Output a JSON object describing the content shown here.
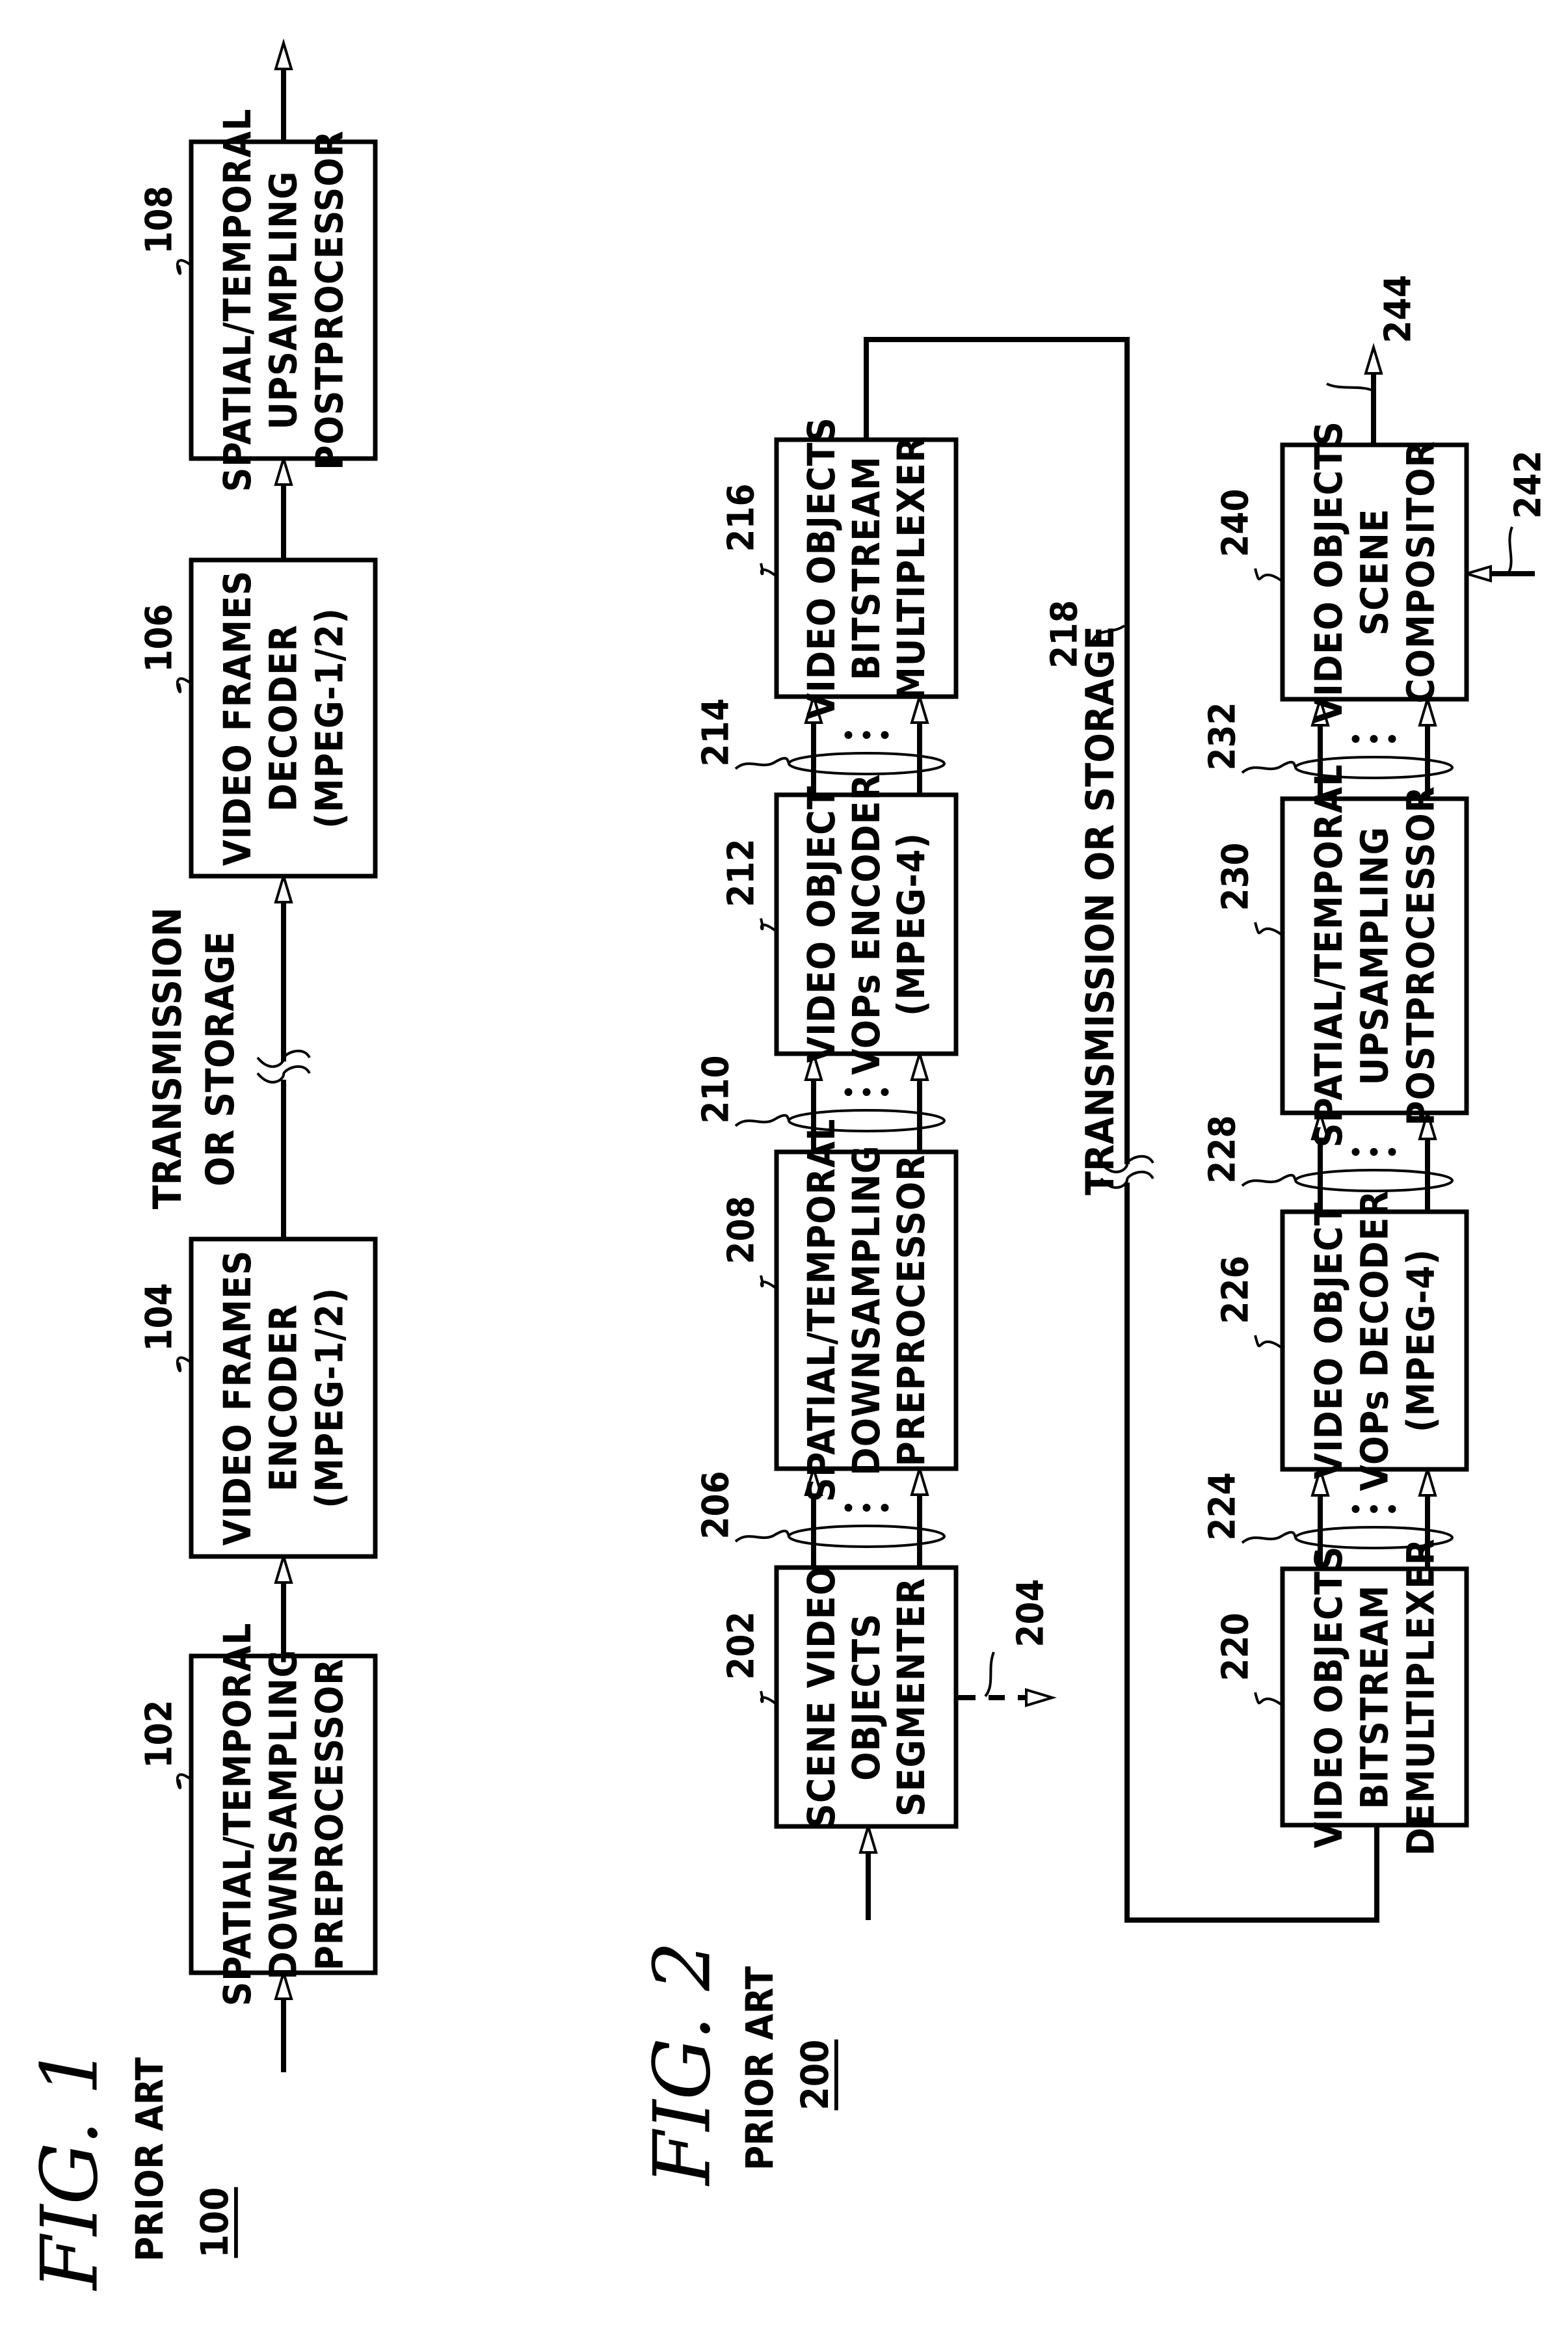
{
  "figure1": {
    "title": "FIG. 1",
    "subtitle": "PRIOR ART",
    "ref": "100",
    "channel_label_lines": [
      "TRANSMISSION",
      "OR STORAGE"
    ],
    "blocks": [
      {
        "ref": "102",
        "lines": [
          "SPATIAL/TEMPORAL",
          "DOWNSAMPLING",
          "PREPROCESSOR"
        ]
      },
      {
        "ref": "104",
        "lines": [
          "VIDEO FRAMES",
          "ENCODER",
          "(MPEG-1/2)"
        ]
      },
      {
        "ref": "106",
        "lines": [
          "VIDEO FRAMES",
          "DECODER",
          "(MPEG-1/2)"
        ]
      },
      {
        "ref": "108",
        "lines": [
          "SPATIAL/TEMPORAL",
          "UPSAMPLING",
          "POSTPROCESSOR"
        ]
      }
    ]
  },
  "figure2": {
    "title": "FIG. 2",
    "subtitle": "PRIOR ART",
    "ref": "200",
    "channel_label": "TRANSMISSION OR STORAGE",
    "channel_ref": "218",
    "encoder_chain": [
      {
        "ref": "202",
        "lines": [
          "SCENE VIDEO",
          "OBJECTS",
          "SEGMENTER"
        ]
      },
      {
        "ref": "208",
        "lines": [
          "SPATIAL/TEMPORAL",
          "DOWNSAMPLING",
          "PREPROCESSOR"
        ]
      },
      {
        "ref": "212",
        "lines": [
          "VIDEO OBJECT",
          "VOPs ENCODER",
          "(MPEG-4)"
        ]
      },
      {
        "ref": "216",
        "lines": [
          "VIDEO OBJECTS",
          "BITSTREAM",
          "MULTIPLEXER"
        ]
      }
    ],
    "decoder_chain": [
      {
        "ref": "220",
        "lines": [
          "VIDEO OBJECTS",
          "BITSTREAM",
          "DEMULTIPLEXER"
        ]
      },
      {
        "ref": "226",
        "lines": [
          "VIDEO OBJECT",
          "VOPs DECODER",
          "(MPEG-4)"
        ]
      },
      {
        "ref": "230",
        "lines": [
          "SPATIAL/TEMPORAL",
          "UPSAMPLING",
          "POSTPROCESSOR"
        ]
      },
      {
        "ref": "240",
        "lines": [
          "VIDEO OBJECTS",
          "SCENE",
          "COMPOSITOR"
        ]
      }
    ],
    "bus_refs": {
      "encoder": [
        "206",
        "210",
        "214"
      ],
      "decoder": [
        "224",
        "228",
        "232"
      ]
    },
    "segmenter_output_ref": "204",
    "compositor_input_ref": "242",
    "compositor_output_ref": "244",
    "ellipsis": "• • •"
  }
}
